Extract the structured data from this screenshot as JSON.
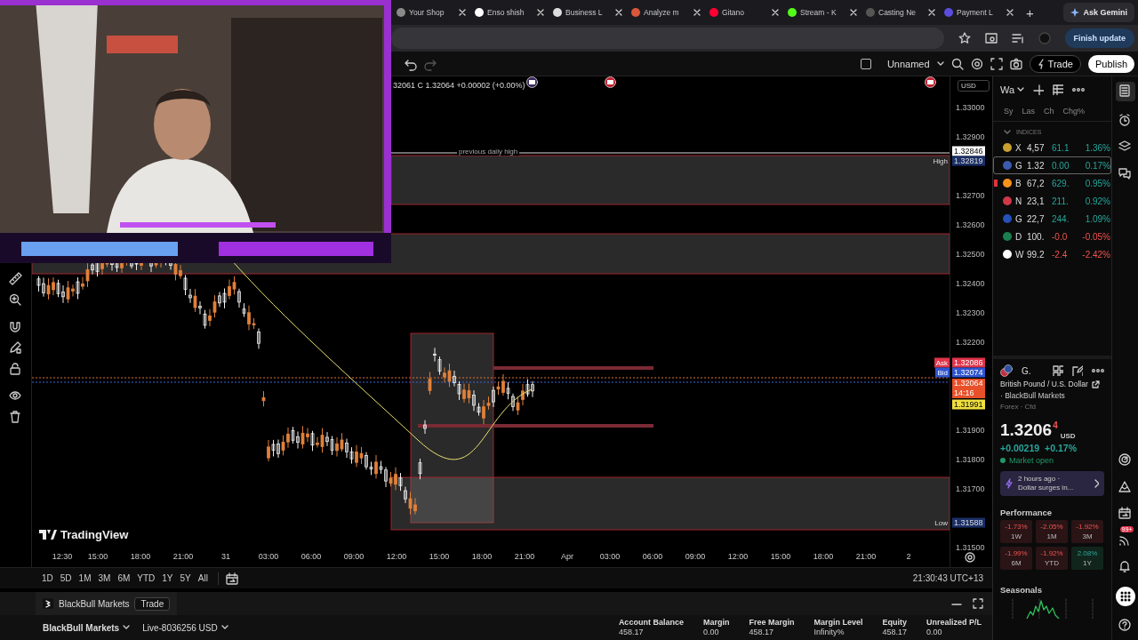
{
  "browser": {
    "tabs": [
      {
        "title": "Your Shop",
        "selected": false
      },
      {
        "title": "Enso shish",
        "selected": false
      },
      {
        "title": "Business L",
        "selected": false
      },
      {
        "title": "Analyze m",
        "selected": false
      },
      {
        "title": "Gitano",
        "selected": false
      },
      {
        "title": "Stream - K",
        "selected": false
      },
      {
        "title": "Casting Ne",
        "selected": false
      },
      {
        "title": "Payment L",
        "selected": false
      }
    ],
    "new_tab": "+",
    "gemini": "Ask Gemini",
    "update": "Finish update"
  },
  "toolbar": {
    "layout_checked": false,
    "layout_name": "Unnamed",
    "trade": "Trade",
    "publish": "Publish"
  },
  "chart": {
    "ohlc": "32061 C 1.32064 +0.00002 (+0.00%)",
    "currency": "USD",
    "level_label": "previous daily high",
    "logo": "TradingView",
    "price_labels": [
      "1.33000",
      "1.32900",
      "1.32700",
      "1.32600",
      "1.32500",
      "1.32400",
      "1.32300",
      "1.32200",
      "1.31900",
      "1.31800",
      "1.31700",
      "1.31500"
    ],
    "badges": [
      {
        "kind": "plain",
        "value": "1.32846"
      },
      {
        "kind": "high",
        "label": "High",
        "value": "1.32819"
      },
      {
        "kind": "ask",
        "label": "Ask",
        "value": "1.32086"
      },
      {
        "kind": "bid",
        "label": "Bid",
        "value": "1.32074"
      },
      {
        "kind": "last",
        "value": "1.32064",
        "sub": "14:16"
      },
      {
        "kind": "yellow",
        "value": "1.31991"
      },
      {
        "kind": "low",
        "label": "Low",
        "value": "1.31588"
      }
    ],
    "time_labels": [
      "12:30",
      "15:00",
      "18:00",
      "21:00",
      "31",
      "03:00",
      "06:00",
      "09:00",
      "12:00",
      "15:00",
      "18:00",
      "21:00",
      "Apr",
      "03:00",
      "06:00",
      "09:00",
      "12:00",
      "15:00",
      "18:00",
      "21:00",
      "2"
    ]
  },
  "ranges": [
    "1D",
    "5D",
    "1M",
    "3M",
    "6M",
    "YTD",
    "1Y",
    "5Y",
    "All"
  ],
  "clock": "21:30:43 UTC+13",
  "trading_panel": {
    "broker_tab": "BlackBull Markets",
    "trade": "Trade",
    "broker": "BlackBull Markets",
    "account": "Live-8036256 USD",
    "stats": [
      {
        "label": "Account Balance",
        "value": "458.17"
      },
      {
        "label": "Margin",
        "value": "0.00"
      },
      {
        "label": "Free Margin",
        "value": "458.17"
      },
      {
        "label": "Margin Level",
        "value": "Infinity%"
      },
      {
        "label": "Equity",
        "value": "458.17"
      },
      {
        "label": "Unrealized P/L",
        "value": "0.00"
      }
    ]
  },
  "watchlist": {
    "title": "Wa",
    "columns": [
      "Sy",
      "Las",
      "Ch",
      "Chg%"
    ],
    "section": {
      "title": "INDICES",
      "expanded": true
    },
    "rows": [
      {
        "symbol": "X",
        "last": "4,57",
        "change": "61.1",
        "change_pct": "1.36%",
        "negative": false,
        "color": "#c9a030",
        "selected": false,
        "flagged": false
      },
      {
        "symbol": "G",
        "last": "1.32",
        "change": "0.00",
        "change_pct": "0.17%",
        "negative": false,
        "color": "#3b5bb0",
        "selected": true,
        "flagged": false
      },
      {
        "symbol": "B",
        "last": "67,2",
        "change": "629.",
        "change_pct": "0.95%",
        "negative": false,
        "color": "#f7931a",
        "selected": false,
        "flagged": true
      },
      {
        "symbol": "N",
        "last": "23,1",
        "change": "211.",
        "change_pct": "0.92%",
        "negative": false,
        "color": "#d03848",
        "selected": false,
        "flagged": false
      },
      {
        "symbol": "G",
        "last": "22,7",
        "change": "244.",
        "change_pct": "1.09%",
        "negative": false,
        "color": "#2450b8",
        "selected": false,
        "flagged": false
      },
      {
        "symbol": "D",
        "last": "100.",
        "change": "-0.0",
        "change_pct": "-0.05%",
        "negative": true,
        "color": "#1a8050",
        "selected": false,
        "flagged": false
      },
      {
        "symbol": "W",
        "last": "99.2",
        "change": "-2.4",
        "change_pct": "-2.42%",
        "negative": true,
        "color": "#ffffff",
        "selected": false,
        "flagged": false
      }
    ]
  },
  "details": {
    "symbol": "G.",
    "name": "British Pound / U.S. Dollar",
    "broker": "· BlackBull Markets",
    "category": "Forex · Cfd",
    "price": "1.3206",
    "price_last_digit": "4",
    "currency": "USD",
    "change": "+0.00219",
    "change_pct": "+0.17%",
    "market_status": "Market open",
    "news": {
      "time": "2 hours ago ·",
      "headline": "Dollar surges in..."
    },
    "performance_title": "Performance",
    "performance": [
      {
        "value": "-1.73%",
        "period": "1W",
        "negative": true
      },
      {
        "value": "-2.05%",
        "period": "1M",
        "negative": true
      },
      {
        "value": "-1.92%",
        "period": "3M",
        "negative": true
      },
      {
        "value": "-1.99%",
        "period": "6M",
        "negative": true
      },
      {
        "value": "-1.92%",
        "period": "YTD",
        "negative": true
      },
      {
        "value": "2.08%",
        "period": "1Y",
        "negative": false
      }
    ],
    "seasonals_title": "Seasonals"
  },
  "side_badge": "99+"
}
